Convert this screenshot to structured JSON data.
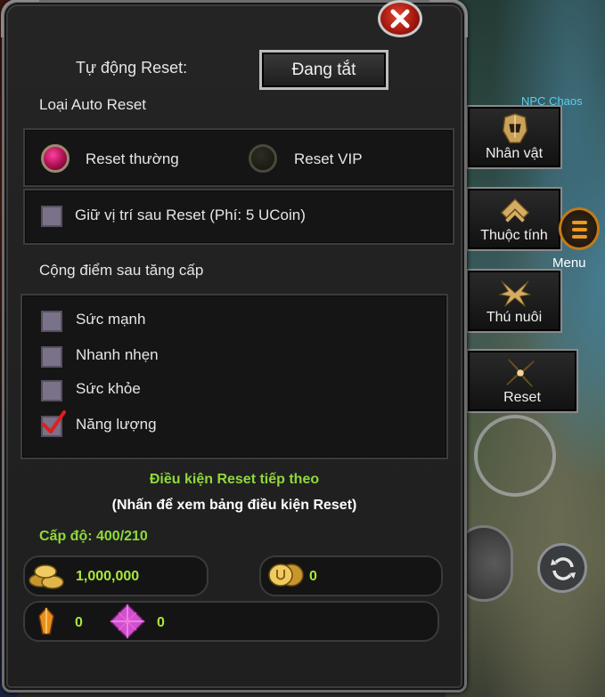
{
  "header": {
    "auto_reset_label": "Tự động Reset:",
    "toggle_button_label": "Đang tắt"
  },
  "reset_type": {
    "heading": "Loại Auto Reset",
    "options": [
      {
        "label": "Reset thường",
        "selected": true
      },
      {
        "label": "Reset VIP",
        "selected": false
      }
    ]
  },
  "keep_position": {
    "label": "Giữ vị trí sau Reset (Phí: 5 UCoin)",
    "checked": false
  },
  "points": {
    "heading": "Cộng điểm sau tăng cấp",
    "items": [
      {
        "label": "Sức mạnh",
        "checked": false
      },
      {
        "label": "Nhanh nhẹn",
        "checked": false
      },
      {
        "label": "Sức khỏe",
        "checked": false
      },
      {
        "label": "Năng lượng",
        "checked": true
      }
    ]
  },
  "condition": {
    "title": "Điều kiện Reset tiếp theo",
    "subtitle": "(Nhấn để xem bảng điều kiện Reset)",
    "level": "Cấp độ: 400/210"
  },
  "currency": {
    "zen": "1,000,000",
    "ucoin": "0",
    "gem_1": "0",
    "gem_2": "0"
  },
  "side_menu": {
    "npc_tag": "NPC Chaos",
    "items": [
      {
        "label": "Nhân vật",
        "icon": "helmet-icon"
      },
      {
        "label": "Thuộc tính",
        "icon": "chevron-up-icon"
      },
      {
        "label": "Thú nuôi",
        "icon": "wings-icon"
      },
      {
        "label": "Reset",
        "icon": "reset-blades-icon"
      }
    ],
    "menu_label": "Menu"
  },
  "colors": {
    "accent_green": "#8fd93a",
    "value_green": "#a9e83a",
    "close_red": "#c0281a",
    "radio_pink": "#e0247a"
  }
}
